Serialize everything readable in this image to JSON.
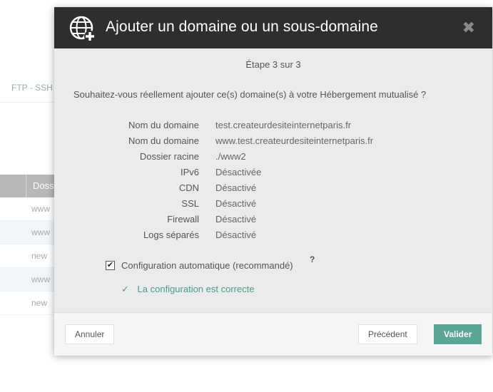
{
  "background": {
    "tab_label": "FTP - SSH",
    "table_header": "Doss",
    "rows": [
      "www",
      "www",
      "new",
      "www",
      "new"
    ]
  },
  "modal": {
    "title": "Ajouter un domaine ou un sous-domaine",
    "close_symbol": "✖",
    "step": "Étape 3 sur 3",
    "question": "Souhaitez-vous réellement ajouter ce(s) domaine(s) à votre Hébergement mutualisé ?",
    "details": [
      {
        "label": "Nom du domaine",
        "value": "test.createurdesiteinternetparis.fr"
      },
      {
        "label": "Nom du domaine",
        "value": "www.test.createurdesiteinternetparis.fr"
      },
      {
        "label": "Dossier racine",
        "value": "./www2"
      },
      {
        "label": "IPv6",
        "value": "Désactivée"
      },
      {
        "label": "CDN",
        "value": "Désactivé"
      },
      {
        "label": "SSL",
        "value": "Désactivé"
      },
      {
        "label": "Firewall",
        "value": "Désactivé"
      },
      {
        "label": "Logs séparés",
        "value": "Désactivé"
      }
    ],
    "auto_config": {
      "checked": true,
      "check_mark": "✔",
      "label": "Configuration automatique (recommandé)",
      "help": "?"
    },
    "status": {
      "check": "✓",
      "text": "La configuration est correcte"
    },
    "buttons": {
      "cancel": "Annuler",
      "previous": "Précédent",
      "validate": "Valider"
    }
  },
  "colors": {
    "header_bg": "#2e2e2e",
    "accent": "#5aa595",
    "success_text": "#4a9a8c"
  },
  "icons": {
    "header": "globe-add-icon"
  }
}
